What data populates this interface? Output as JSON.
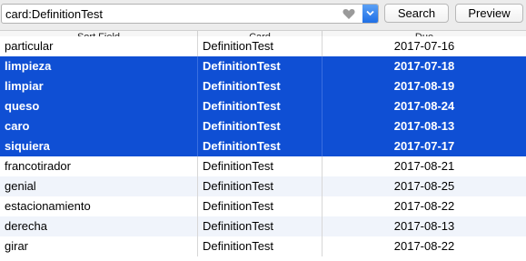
{
  "search": {
    "value": "card:DefinitionTest",
    "search_label": "Search",
    "preview_label": "Preview"
  },
  "table": {
    "columns": [
      "Sort Field",
      "Card",
      "Due"
    ],
    "rows": [
      {
        "sort_field": "particular",
        "card": "DefinitionTest",
        "due": "2017-07-16",
        "selected": false
      },
      {
        "sort_field": "limpieza",
        "card": "DefinitionTest",
        "due": "2017-07-18",
        "selected": true
      },
      {
        "sort_field": "limpiar",
        "card": "DefinitionTest",
        "due": "2017-08-19",
        "selected": true
      },
      {
        "sort_field": "queso",
        "card": "DefinitionTest",
        "due": "2017-08-24",
        "selected": true
      },
      {
        "sort_field": "caro",
        "card": "DefinitionTest",
        "due": "2017-08-13",
        "selected": true
      },
      {
        "sort_field": "siquiera",
        "card": "DefinitionTest",
        "due": "2017-07-17",
        "selected": true
      },
      {
        "sort_field": "francotirador",
        "card": "DefinitionTest",
        "due": "2017-08-21",
        "selected": false
      },
      {
        "sort_field": "genial",
        "card": "DefinitionTest",
        "due": "2017-08-25",
        "selected": false
      },
      {
        "sort_field": "estacionamiento",
        "card": "DefinitionTest",
        "due": "2017-08-22",
        "selected": false
      },
      {
        "sort_field": "derecha",
        "card": "DefinitionTest",
        "due": "2017-08-13",
        "selected": false
      },
      {
        "sort_field": "girar",
        "card": "DefinitionTest",
        "due": "2017-08-22",
        "selected": false
      }
    ]
  },
  "colors": {
    "selection": "#0f4fd4",
    "alt_row": "#f0f4fb",
    "accent": "#1f6fe6"
  },
  "icons": {
    "favorite": "heart-icon",
    "dropdown": "chevron-down-icon"
  }
}
